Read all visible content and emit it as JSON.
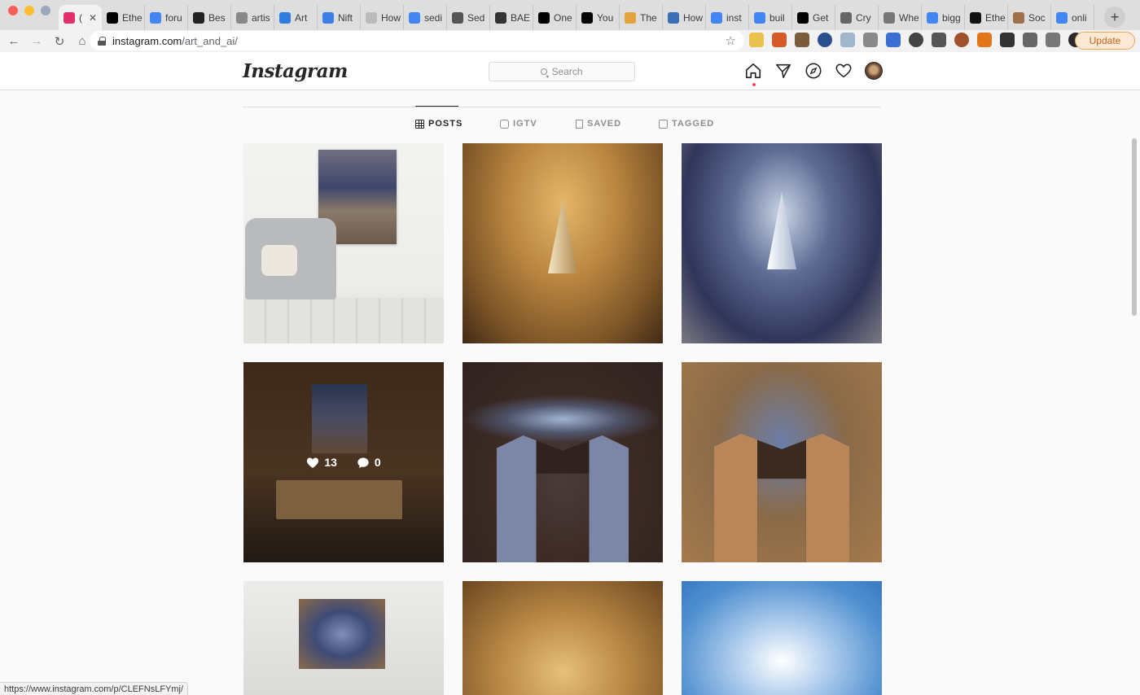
{
  "browser": {
    "tabs": [
      {
        "label": "(",
        "fav_color": "#e1306c",
        "active": true
      },
      {
        "label": "Ethe",
        "fav_color": "#000000"
      },
      {
        "label": "foru",
        "fav_color": "#4285f4"
      },
      {
        "label": "Bes",
        "fav_color": "#222222"
      },
      {
        "label": "artis",
        "fav_color": "#888888"
      },
      {
        "label": "Art",
        "fav_color": "#2f7de1"
      },
      {
        "label": "Nift",
        "fav_color": "#3d7fe6"
      },
      {
        "label": "How",
        "fav_color": "#bbbbbb"
      },
      {
        "label": "sedi",
        "fav_color": "#4285f4"
      },
      {
        "label": "Sed",
        "fav_color": "#555555"
      },
      {
        "label": "BAE",
        "fav_color": "#333333"
      },
      {
        "label": "One",
        "fav_color": "#000000"
      },
      {
        "label": "You",
        "fav_color": "#000000"
      },
      {
        "label": "The",
        "fav_color": "#e6a23c"
      },
      {
        "label": "How",
        "fav_color": "#3c6fb5"
      },
      {
        "label": "inst",
        "fav_color": "#4285f4"
      },
      {
        "label": "buil",
        "fav_color": "#4285f4"
      },
      {
        "label": "Get",
        "fav_color": "#000000"
      },
      {
        "label": "Cry",
        "fav_color": "#666666"
      },
      {
        "label": "Whe",
        "fav_color": "#777777"
      },
      {
        "label": "bigg",
        "fav_color": "#4285f4"
      },
      {
        "label": "Ethe",
        "fav_color": "#111111"
      },
      {
        "label": "Soc",
        "fav_color": "#a0704a"
      },
      {
        "label": "onli",
        "fav_color": "#4285f4"
      }
    ],
    "url_host": "instagram.com",
    "url_path": "/art_and_ai/",
    "update_label": "Update",
    "status_url": "https://www.instagram.com/p/CLEFNsLFYmj/"
  },
  "header": {
    "logo": "Instagram",
    "search_placeholder": "Search"
  },
  "profile_tabs": [
    {
      "label": "POSTS",
      "active": true
    },
    {
      "label": "IGTV",
      "active": false
    },
    {
      "label": "SAVED",
      "active": false
    },
    {
      "label": "TAGGED",
      "active": false
    }
  ],
  "hover_stats": {
    "likes": "13",
    "comments": "0"
  },
  "colors": {
    "accent": "#ed4956",
    "border": "#dbdbdb",
    "text": "#262626",
    "muted": "#8e8e8e"
  }
}
